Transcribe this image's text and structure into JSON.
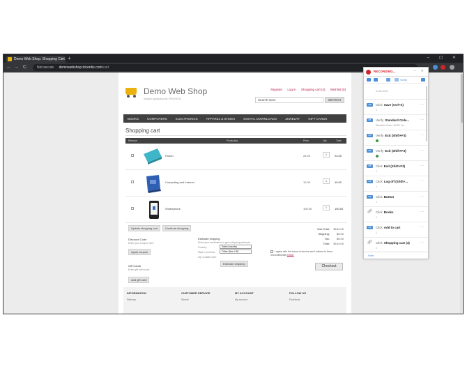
{
  "browser": {
    "tab_title": "Demo Web Shop. Shopping Cart",
    "tab_close": "×",
    "new_tab": "+",
    "window_controls": "– ▢ ✕",
    "nav_back": "←",
    "nav_forward": "→",
    "nav_reload": "C",
    "security": "Not secure",
    "url_host": "demowebshop.tricentis.com",
    "url_path": "/cart"
  },
  "shop": {
    "name": "Demo Web Shop",
    "subtitle": "Sample Application by TRICENTIS",
    "header_links": [
      "Register",
      "Log in",
      "Shopping cart (4)",
      "Wishlist (0)"
    ],
    "search_placeholder": "Search store",
    "search_button": "SEARCH",
    "menu": [
      "BOOKS",
      "COMPUTERS",
      "ELECTRONICS",
      "APPAREL & SHOES",
      "DIGITAL DOWNLOADS",
      "JEWELRY",
      "GIFT CARDS"
    ]
  },
  "cart": {
    "title": "Shopping cart",
    "columns": {
      "remove": "Remove",
      "product": "Product(s)",
      "price": "Price",
      "qty": "Qty.",
      "total": "Total"
    },
    "items": [
      {
        "name": "Fiction",
        "price": "24.00",
        "qty": "1",
        "total": "24.00"
      },
      {
        "name": "Computing and Internet",
        "price": "10.00",
        "qty": "1",
        "total": "10.00"
      },
      {
        "name": "Smartphone",
        "price": "100.00",
        "qty": "1",
        "total": "100.00"
      }
    ],
    "update_button": "Update shopping cart",
    "continue_button": "Continue shopping"
  },
  "discount": {
    "title": "Discount Code",
    "text": "Enter your coupon here",
    "button": "Apply coupon"
  },
  "giftcard": {
    "title": "Gift Cards",
    "text": "Enter gift card code",
    "button": "Add gift card"
  },
  "estimate": {
    "title": "Estimate shipping",
    "text": "Enter your destination to get a shipping estimate",
    "country_label": "Country:",
    "country_value": "Select country",
    "state_label": "State / province:",
    "state_value": "Other (Non US)",
    "zip_label": "Zip / postal code:",
    "button": "Estimate shipping"
  },
  "totals": {
    "rows": [
      {
        "label": "Sub-Total:",
        "value": "$134.00"
      },
      {
        "label": "Shipping:",
        "value": "$0.00"
      },
      {
        "label": "Tax:",
        "value": "$0.00"
      },
      {
        "label": "Total:",
        "value": "$134.00"
      }
    ],
    "terms": "I agree with the terms of service and I adhere to them unconditionally",
    "terms_link": "(read)",
    "checkout": "Checkout"
  },
  "footer": {
    "columns": [
      {
        "heading": "INFORMATION",
        "item": "Sitemap"
      },
      {
        "heading": "CUSTOMER SERVICE",
        "item": "Search"
      },
      {
        "heading": "MY ACCOUNT",
        "item": "My account"
      },
      {
        "heading": "FOLLOW US",
        "item": "Facebook"
      }
    ]
  },
  "recorder": {
    "title": "RECORDING...",
    "window_controls": "– ✕",
    "verify_label": "Verify",
    "steps": [
      {
        "icon": "",
        "verb": "",
        "target": "",
        "sub": "04.05.2020"
      },
      {
        "icon": "KB",
        "verb": "Click",
        "target": "Save (Ctrl+S)",
        "sub": "1"
      },
      {
        "icon": "KB",
        "verb": "Verify",
        "target": "Standard Orde...",
        "sub": "Standard Order 40000 ha..."
      },
      {
        "icon": "KB",
        "verb": "Verify",
        "target": "Exit (Shift+F3)",
        "sub": ""
      },
      {
        "icon": "KB",
        "verb": "Verify",
        "target": "Exit (Shift+F3)",
        "sub": ""
      },
      {
        "icon": "KB",
        "verb": "Click",
        "target": "Exit (Shift+F3)",
        "sub": "1"
      },
      {
        "icon": "KB",
        "verb": "Click",
        "target": "Log off (Shift+...",
        "sub": "1"
      },
      {
        "icon": "KB",
        "verb": "Click",
        "target": "Button",
        "sub": "1"
      },
      {
        "icon": "link",
        "verb": "Click",
        "target": "Books",
        "sub": "1"
      },
      {
        "icon": "KB",
        "verb": "Click",
        "target": "Add to cart",
        "sub": "1"
      },
      {
        "icon": "link",
        "verb": "Click",
        "target": "Shopping cart (4)",
        "sub": "1"
      }
    ],
    "footer": "Hide",
    "more": "···"
  },
  "colors": {
    "accent_red": "#b41e47",
    "brand_yellow": "#e9b20f",
    "menu_bg": "#404040",
    "recorder_blue": "#4c8fd6"
  }
}
